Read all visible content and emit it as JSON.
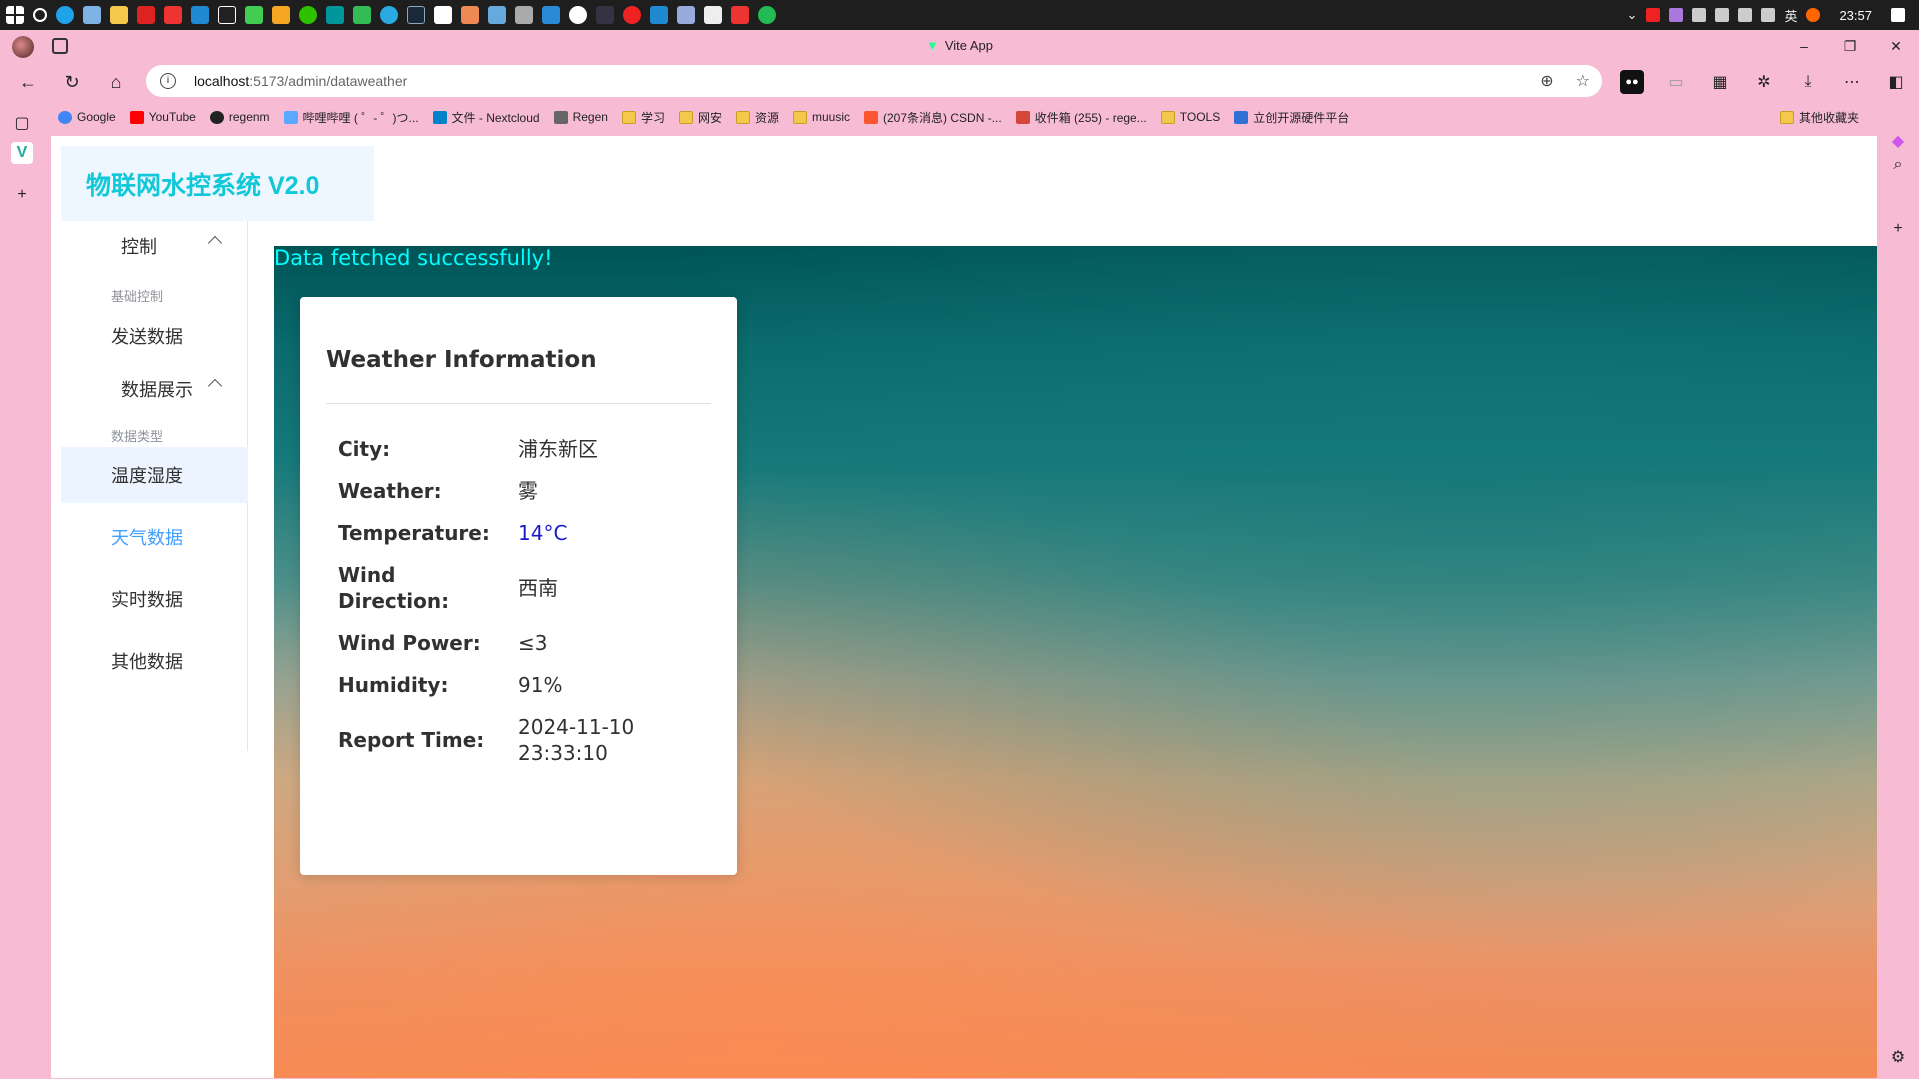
{
  "taskbar": {
    "time": "23:57",
    "ime": "英"
  },
  "window": {
    "title": "Vite App"
  },
  "address": {
    "host": "localhost",
    "path": ":5173/admin/dataweather"
  },
  "bookmarks": [
    {
      "label": "Google",
      "color": "#4285f4"
    },
    {
      "label": "YouTube",
      "color": "#ff0000"
    },
    {
      "label": "regenm",
      "color": "#222222"
    },
    {
      "label": "哔哩哔哩 ( ゜- ゜)つ...",
      "color": "#5aa8ff"
    },
    {
      "label": "文件 - Nextcloud",
      "color": "#0082c9"
    },
    {
      "label": "Regen",
      "color": "#666666"
    },
    {
      "label": "学习",
      "color": "#f3c84b"
    },
    {
      "label": "网安",
      "color": "#f3c84b"
    },
    {
      "label": "资源",
      "color": "#f3c84b"
    },
    {
      "label": "muusic",
      "color": "#f3c84b"
    },
    {
      "label": "(207条消息) CSDN -...",
      "color": "#fc5531"
    },
    {
      "label": "收件箱 (255) - rege...",
      "color": "#d44638"
    },
    {
      "label": "TOOLS",
      "color": "#f3c84b"
    },
    {
      "label": "立创开源硬件平台",
      "color": "#2f6fd6"
    }
  ],
  "bookmarks_other": "其他收藏夹",
  "app": {
    "logo": "物联网水控系统 V2.0",
    "menu": {
      "group1": "控制",
      "group1_sub": "基础控制",
      "send": "发送数据",
      "group2": "数据展示",
      "group2_sub": "数据类型",
      "temp_humidity": "温度湿度",
      "weather": "天气数据",
      "realtime": "实时数据",
      "other": "其他数据"
    },
    "status": "Data fetched successfully!",
    "card": {
      "title": "Weather Information",
      "rows": [
        {
          "key": "City:",
          "value": "浦东新区"
        },
        {
          "key": "Weather:",
          "value": "雾"
        },
        {
          "key": "Temperature:",
          "value": "14°C"
        },
        {
          "key": "Wind Direction:",
          "value": "西南"
        },
        {
          "key": "Wind Power:",
          "value": "≤3"
        },
        {
          "key": "Humidity:",
          "value": "91%"
        },
        {
          "key": "Report Time:",
          "value": "2024-11-10 23:33:10"
        }
      ]
    }
  }
}
